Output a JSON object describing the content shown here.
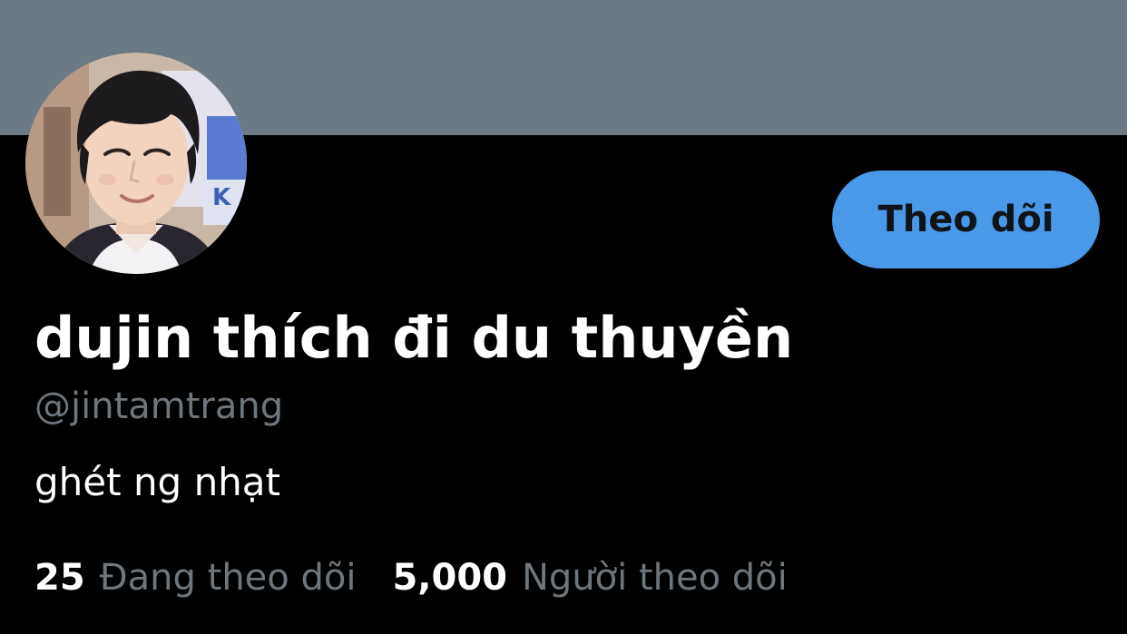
{
  "profile": {
    "display_name": "dujin thích đi du thuyền",
    "handle": "@jintamtrang",
    "bio": "ghét ng nhạt",
    "follow_label": "Theo dõi",
    "following": {
      "count": "25",
      "label": "Đang theo dõi"
    },
    "followers": {
      "count": "5,000",
      "label": "Người theo dõi"
    }
  },
  "colors": {
    "banner": "#6c7a86",
    "background": "#000000",
    "accent": "#4a99e9",
    "secondary_text": "#6e767d",
    "primary_text": "#ffffff"
  },
  "icons": {
    "avatar": "profile-photo"
  }
}
